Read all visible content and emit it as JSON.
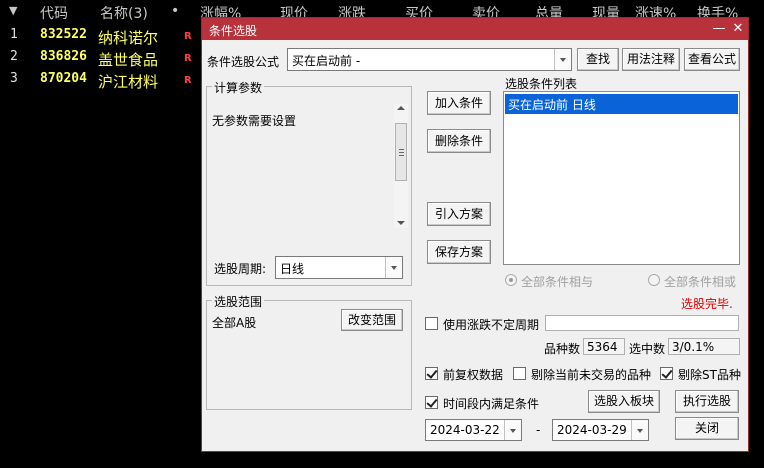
{
  "grid": {
    "columns": [
      "代码",
      "名称(3)",
      "•",
      "涨幅%",
      "现价",
      "涨跌",
      "买价",
      "卖价",
      "总量",
      "现量",
      "涨速%",
      "换手%"
    ],
    "rows": [
      {
        "idx": "1",
        "code": "832522",
        "name": "纳科诺尔",
        "flag": "R"
      },
      {
        "idx": "2",
        "code": "836826",
        "name": "盖世食品",
        "flag": "R"
      },
      {
        "idx": "3",
        "code": "870204",
        "name": "沪江材料",
        "flag": "R"
      }
    ]
  },
  "dialog": {
    "title": "条件选股",
    "formula_label": "条件选股公式",
    "formula_value": "买在启动前   -",
    "find_btn": "查找",
    "usage_btn": "用法注释",
    "view_btn": "查看公式",
    "params_group": "计算参数",
    "no_params": "无参数需要设置",
    "period_label": "选股周期:",
    "period_value": "日线",
    "add_btn": "加入条件",
    "del_btn": "删除条件",
    "import_btn": "引入方案",
    "save_btn": "保存方案",
    "list_title": "选股条件列表",
    "list_items": [
      "买在启动前  日线"
    ],
    "radio_and": "全部条件相与",
    "radio_or": "全部条件相或",
    "status": "选股完毕.",
    "range_group": "选股范围",
    "range_value": "全部A股",
    "change_range_btn": "改变范围",
    "indef_period": "使用涨跌不定周期",
    "count_label": "品种数",
    "count_value": "5364",
    "selected_label": "选中数",
    "selected_value": "3/0.1%",
    "adjust": "前复权数据",
    "exclude_untraded": "剔除当前未交易的品种",
    "exclude_st": "剔除ST品种",
    "time_cond": "时间段内满足条件",
    "to_block_btn": "选股入板块",
    "run_btn": "执行选股",
    "date_from": "2024-03-22",
    "date_sep": "-",
    "date_to": "2024-03-29",
    "close_btn": "关闭"
  },
  "colors": {
    "titlebar": "#b8323c",
    "selection": "#0a64d8",
    "status": "#e00000",
    "stock_text": "#ffff66"
  },
  "icons": {
    "sort_arrow": "triangle-down-icon",
    "minimize": "minimize-icon",
    "close": "close-icon"
  }
}
